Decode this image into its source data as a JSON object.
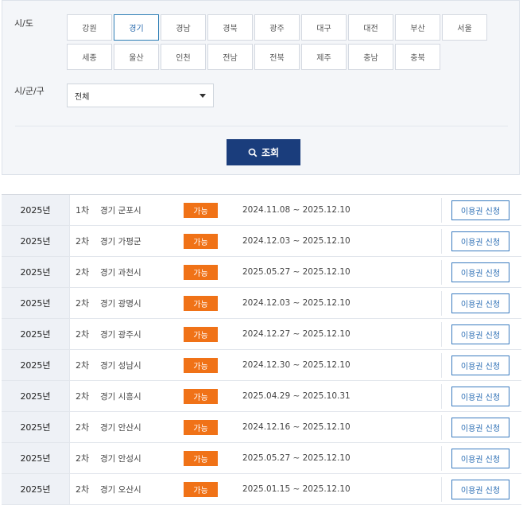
{
  "filters": {
    "province_label": "시/도",
    "district_label": "시/군/구",
    "provinces": [
      "강원",
      "경기",
      "경남",
      "경북",
      "광주",
      "대구",
      "대전",
      "부산",
      "서울",
      "세종",
      "울산",
      "인천",
      "전남",
      "전북",
      "제주",
      "충남",
      "충북"
    ],
    "selected_province": "경기",
    "district_value": "전체",
    "search_label": "조회"
  },
  "colors": {
    "accent_navy": "#1a3d7c",
    "badge_orange": "#f07217",
    "selected_border": "#2f7fb6"
  },
  "rows": [
    {
      "year": "2025년",
      "round": "1차",
      "region": "경기 군포시",
      "status": "가능",
      "period": "2024.11.08 ~ 2025.12.10",
      "action": "이용권 신청"
    },
    {
      "year": "2025년",
      "round": "2차",
      "region": "경기 가평군",
      "status": "가능",
      "period": "2024.12.03 ~ 2025.12.10",
      "action": "이용권 신청"
    },
    {
      "year": "2025년",
      "round": "2차",
      "region": "경기 과천시",
      "status": "가능",
      "period": "2025.05.27 ~ 2025.12.10",
      "action": "이용권 신청"
    },
    {
      "year": "2025년",
      "round": "2차",
      "region": "경기 광명시",
      "status": "가능",
      "period": "2024.12.03 ~ 2025.12.10",
      "action": "이용권 신청"
    },
    {
      "year": "2025년",
      "round": "2차",
      "region": "경기 광주시",
      "status": "가능",
      "period": "2024.12.27 ~ 2025.12.10",
      "action": "이용권 신청"
    },
    {
      "year": "2025년",
      "round": "2차",
      "region": "경기 성남시",
      "status": "가능",
      "period": "2024.12.30 ~ 2025.12.10",
      "action": "이용권 신청"
    },
    {
      "year": "2025년",
      "round": "2차",
      "region": "경기 시흥시",
      "status": "가능",
      "period": "2025.04.29 ~ 2025.10.31",
      "action": "이용권 신청"
    },
    {
      "year": "2025년",
      "round": "2차",
      "region": "경기 안산시",
      "status": "가능",
      "period": "2024.12.16 ~ 2025.12.10",
      "action": "이용권 신청"
    },
    {
      "year": "2025년",
      "round": "2차",
      "region": "경기 안성시",
      "status": "가능",
      "period": "2025.05.27 ~ 2025.12.10",
      "action": "이용권 신청"
    },
    {
      "year": "2025년",
      "round": "2차",
      "region": "경기 오산시",
      "status": "가능",
      "period": "2025.01.15 ~ 2025.12.10",
      "action": "이용권 신청"
    }
  ]
}
